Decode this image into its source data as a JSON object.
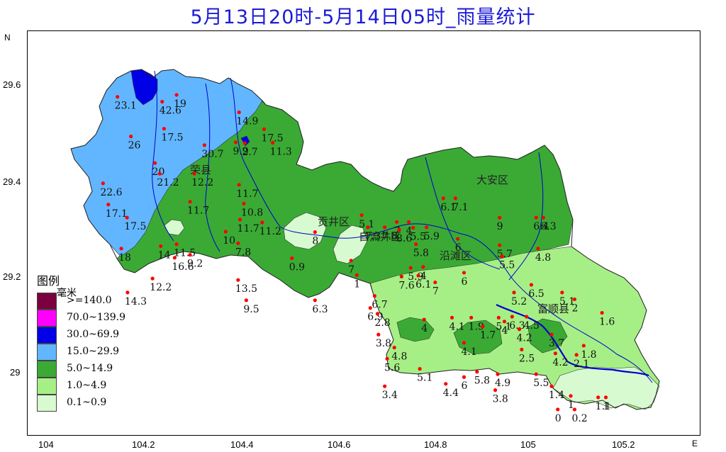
{
  "title": "5月13日20时-5月14日05时_雨量统计",
  "compass": {
    "north": "N",
    "east": "E"
  },
  "axes": {
    "y_ticks": [
      "29.6",
      "29.4",
      "29.2",
      "29"
    ],
    "x_ticks": [
      "104",
      "104.2",
      "104.4",
      "104.6",
      "104.8",
      "105",
      "105.2"
    ]
  },
  "legend": {
    "title": "图例",
    "unit": "毫米",
    "items": [
      {
        "label": ">=140.0",
        "color": "#7a0040"
      },
      {
        "label": "70.0~139.9",
        "color": "#ff00ff"
      },
      {
        "label": "30.0~69.9",
        "color": "#0000e6"
      },
      {
        "label": "15.0~29.9",
        "color": "#62b6ff"
      },
      {
        "label": "5.0~14.9",
        "color": "#3aaa35"
      },
      {
        "label": "1.0~4.9",
        "color": "#a6ef86"
      },
      {
        "label": "0.1~0.9",
        "color": "#d8fad0"
      }
    ]
  },
  "districts": [
    "荣县",
    "贡井区",
    "自流井区",
    "大安区",
    "沿滩区",
    "富顺县"
  ],
  "stations": [
    {
      "lon": 104.147,
      "lat": 29.577,
      "value": "23.1"
    },
    {
      "lon": 104.24,
      "lat": 29.567,
      "value": "42.6"
    },
    {
      "lon": 104.27,
      "lat": 29.581,
      "value": "19"
    },
    {
      "lon": 104.244,
      "lat": 29.511,
      "value": "17.5"
    },
    {
      "lon": 104.175,
      "lat": 29.495,
      "value": "26"
    },
    {
      "lon": 104.225,
      "lat": 29.44,
      "value": "20"
    },
    {
      "lon": 104.235,
      "lat": 29.418,
      "value": "21.2"
    },
    {
      "lon": 104.117,
      "lat": 29.398,
      "value": "22.6"
    },
    {
      "lon": 104.128,
      "lat": 29.354,
      "value": "17.1"
    },
    {
      "lon": 104.167,
      "lat": 29.327,
      "value": "17.5"
    },
    {
      "lon": 104.155,
      "lat": 29.263,
      "value": "18"
    },
    {
      "lon": 104.168,
      "lat": 29.172,
      "value": "14.3"
    },
    {
      "lon": 104.22,
      "lat": 29.201,
      "value": "12.2"
    },
    {
      "lon": 104.237,
      "lat": 29.268,
      "value": "14"
    },
    {
      "lon": 104.27,
      "lat": 29.272,
      "value": "11.5"
    },
    {
      "lon": 104.266,
      "lat": 29.244,
      "value": "16.6"
    },
    {
      "lon": 104.298,
      "lat": 29.25,
      "value": "9.2"
    },
    {
      "lon": 104.328,
      "lat": 29.477,
      "value": "30.7"
    },
    {
      "lon": 104.307,
      "lat": 29.418,
      "value": "12.2"
    },
    {
      "lon": 104.298,
      "lat": 29.36,
      "value": "11.7"
    },
    {
      "lon": 104.4,
      "lat": 29.545,
      "value": "14.9"
    },
    {
      "lon": 104.393,
      "lat": 29.483,
      "value": "9.9"
    },
    {
      "lon": 104.412,
      "lat": 29.481,
      "value": "2.7"
    },
    {
      "lon": 104.452,
      "lat": 29.51,
      "value": "17.5"
    },
    {
      "lon": 104.47,
      "lat": 29.482,
      "value": "11.3"
    },
    {
      "lon": 104.4,
      "lat": 29.395,
      "value": "11.7"
    },
    {
      "lon": 104.41,
      "lat": 29.356,
      "value": "10.8"
    },
    {
      "lon": 104.372,
      "lat": 29.298,
      "value": "10"
    },
    {
      "lon": 104.402,
      "lat": 29.323,
      "value": "11.7"
    },
    {
      "lon": 104.448,
      "lat": 29.317,
      "value": "11.2"
    },
    {
      "lon": 104.398,
      "lat": 29.274,
      "value": "7.8"
    },
    {
      "lon": 104.398,
      "lat": 29.198,
      "value": "13.5"
    },
    {
      "lon": 104.415,
      "lat": 29.156,
      "value": "9.5"
    },
    {
      "lon": 104.558,
      "lat": 29.297,
      "value": "8"
    },
    {
      "lon": 104.51,
      "lat": 29.243,
      "value": "0.9"
    },
    {
      "lon": 104.558,
      "lat": 29.156,
      "value": "6.3"
    },
    {
      "lon": 104.633,
      "lat": 29.238,
      "value": "7"
    },
    {
      "lon": 104.645,
      "lat": 29.208,
      "value": "1"
    },
    {
      "lon": 104.655,
      "lat": 29.332,
      "value": "5.1"
    },
    {
      "lon": 104.668,
      "lat": 29.307,
      "value": "7.3"
    },
    {
      "lon": 104.703,
      "lat": 29.307,
      "value": "7.8"
    },
    {
      "lon": 104.728,
      "lat": 29.318,
      "value": "7"
    },
    {
      "lon": 104.733,
      "lat": 29.302,
      "value": "8.6"
    },
    {
      "lon": 104.753,
      "lat": 29.318,
      "value": "4"
    },
    {
      "lon": 104.762,
      "lat": 29.306,
      "value": "5.5"
    },
    {
      "lon": 104.79,
      "lat": 29.307,
      "value": "5.9"
    },
    {
      "lon": 104.768,
      "lat": 29.272,
      "value": "5.8"
    },
    {
      "lon": 104.757,
      "lat": 29.223,
      "value": "5.9"
    },
    {
      "lon": 104.783,
      "lat": 29.225,
      "value": "4"
    },
    {
      "lon": 104.738,
      "lat": 29.205,
      "value": "7.6"
    },
    {
      "lon": 104.773,
      "lat": 29.207,
      "value": "6.1"
    },
    {
      "lon": 104.682,
      "lat": 29.165,
      "value": "6.7"
    },
    {
      "lon": 104.673,
      "lat": 29.14,
      "value": "6.9"
    },
    {
      "lon": 104.688,
      "lat": 29.128,
      "value": "2.8"
    },
    {
      "lon": 104.69,
      "lat": 29.085,
      "value": "3.8"
    },
    {
      "lon": 104.708,
      "lat": 29.035,
      "value": "5.6"
    },
    {
      "lon": 104.723,
      "lat": 29.058,
      "value": "4.8"
    },
    {
      "lon": 104.776,
      "lat": 29.014,
      "value": "5.1"
    },
    {
      "lon": 104.703,
      "lat": 28.978,
      "value": "3.4"
    },
    {
      "lon": 104.785,
      "lat": 29.116,
      "value": "4"
    },
    {
      "lon": 104.825,
      "lat": 29.367,
      "value": "6.1"
    },
    {
      "lon": 104.85,
      "lat": 29.367,
      "value": "7.1"
    },
    {
      "lon": 104.942,
      "lat": 29.327,
      "value": "9"
    },
    {
      "lon": 105.018,
      "lat": 29.327,
      "value": "6.4"
    },
    {
      "lon": 105.033,
      "lat": 29.327,
      "value": "6.3"
    },
    {
      "lon": 104.855,
      "lat": 29.283,
      "value": "6"
    },
    {
      "lon": 104.942,
      "lat": 29.27,
      "value": "5.7"
    },
    {
      "lon": 104.947,
      "lat": 29.247,
      "value": "5.5"
    },
    {
      "lon": 105.022,
      "lat": 29.263,
      "value": "4.8"
    },
    {
      "lon": 104.808,
      "lat": 29.193,
      "value": "7"
    },
    {
      "lon": 104.868,
      "lat": 29.213,
      "value": "6"
    },
    {
      "lon": 105.008,
      "lat": 29.188,
      "value": "6.5"
    },
    {
      "lon": 104.972,
      "lat": 29.172,
      "value": "5.2"
    },
    {
      "lon": 105.072,
      "lat": 29.172,
      "value": "5.1"
    },
    {
      "lon": 105.098,
      "lat": 29.158,
      "value": "2"
    },
    {
      "lon": 104.843,
      "lat": 29.12,
      "value": "4.1"
    },
    {
      "lon": 104.883,
      "lat": 29.12,
      "value": "1.9"
    },
    {
      "lon": 104.907,
      "lat": 29.102,
      "value": "1.7"
    },
    {
      "lon": 104.94,
      "lat": 29.12,
      "value": "5.1"
    },
    {
      "lon": 104.952,
      "lat": 29.112,
      "value": "4"
    },
    {
      "lon": 104.968,
      "lat": 29.122,
      "value": "6.3"
    },
    {
      "lon": 104.998,
      "lat": 29.122,
      "value": "4.5"
    },
    {
      "lon": 104.983,
      "lat": 29.096,
      "value": "4.2"
    },
    {
      "lon": 105.05,
      "lat": 29.085,
      "value": "3.7"
    },
    {
      "lon": 105.155,
      "lat": 29.13,
      "value": "1.6"
    },
    {
      "lon": 104.868,
      "lat": 29.068,
      "value": "4.1"
    },
    {
      "lon": 104.988,
      "lat": 29.054,
      "value": "2.5"
    },
    {
      "lon": 105.058,
      "lat": 29.046,
      "value": "4.2"
    },
    {
      "lon": 105.117,
      "lat": 29.062,
      "value": "1.8"
    },
    {
      "lon": 105.102,
      "lat": 29.043,
      "value": "2.1"
    },
    {
      "lon": 104.895,
      "lat": 29.008,
      "value": "5.8"
    },
    {
      "lon": 104.868,
      "lat": 28.997,
      "value": "6"
    },
    {
      "lon": 104.938,
      "lat": 29.003,
      "value": "4.9"
    },
    {
      "lon": 104.83,
      "lat": 28.983,
      "value": "4.4"
    },
    {
      "lon": 104.933,
      "lat": 28.97,
      "value": "3.8"
    },
    {
      "lon": 105.018,
      "lat": 29.003,
      "value": "5.5"
    },
    {
      "lon": 105.05,
      "lat": 28.978,
      "value": "1.4"
    },
    {
      "lon": 105.09,
      "lat": 28.958,
      "value": "1"
    },
    {
      "lon": 105.147,
      "lat": 28.955,
      "value": "1.1"
    },
    {
      "lon": 105.163,
      "lat": 28.955,
      "value": "1"
    },
    {
      "lon": 105.063,
      "lat": 28.93,
      "value": "0"
    },
    {
      "lon": 105.098,
      "lat": 28.93,
      "value": "0.2"
    }
  ]
}
